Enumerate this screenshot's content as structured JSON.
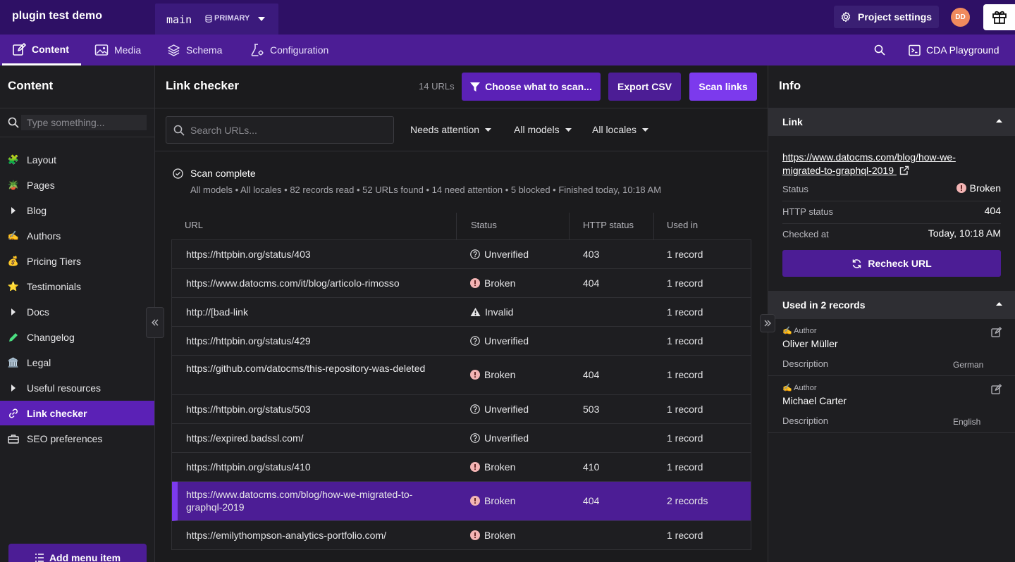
{
  "app": {
    "title": "plugin test demo"
  },
  "environment": {
    "name": "main",
    "badge": "PRIMARY"
  },
  "topbar": {
    "project_settings": "Project settings",
    "avatar_initials": "DD"
  },
  "nav": {
    "tabs": [
      {
        "label": "Content",
        "icon": "edit-icon",
        "active": true
      },
      {
        "label": "Media",
        "icon": "image-icon"
      },
      {
        "label": "Schema",
        "icon": "layers-icon"
      },
      {
        "label": "Configuration",
        "icon": "flask-icon"
      }
    ],
    "cda_playground": "CDA Playground"
  },
  "sidebar": {
    "title": "Content",
    "search_placeholder": "Type something...",
    "items": [
      {
        "label": "Layout",
        "icon": "🧩"
      },
      {
        "label": "Pages",
        "icon": "🪴"
      },
      {
        "label": "Blog",
        "icon": "caret-right-icon"
      },
      {
        "label": "Authors",
        "icon": "✍️"
      },
      {
        "label": "Pricing Tiers",
        "icon": "💰"
      },
      {
        "label": "Testimonials",
        "icon": "⭐"
      },
      {
        "label": "Docs",
        "icon": "caret-right-icon"
      },
      {
        "label": "Changelog",
        "icon": "pencil-icon"
      },
      {
        "label": "Legal",
        "icon": "🏛️"
      },
      {
        "label": "Useful resources",
        "icon": "caret-right-icon"
      },
      {
        "label": "Link checker",
        "icon": "link-icon",
        "active": true
      },
      {
        "label": "SEO preferences",
        "icon": "toolbox-icon"
      }
    ],
    "add_menu_item": "Add menu item"
  },
  "main": {
    "title": "Link checker",
    "url_count": "14 URLs",
    "buttons": {
      "choose": "Choose what to scan...",
      "export": "Export CSV",
      "scan": "Scan links"
    },
    "search_placeholder": "Search URLs...",
    "filters": {
      "attention": "Needs attention",
      "models": "All models",
      "locales": "All locales"
    },
    "scan_status": {
      "title": "Scan complete",
      "summary": "All models • All locales • 82 records read • 52 URLs found • 14 need attention • 5 blocked • Finished today, 10:18 AM"
    },
    "table": {
      "columns": [
        "URL",
        "Status",
        "HTTP status",
        "Used in"
      ],
      "rows": [
        {
          "url": "https://httpbin.org/status/403",
          "status": "Unverified",
          "kind": "unverified",
          "http": "403",
          "used": "1 record"
        },
        {
          "url": "https://www.datocms.com/it/blog/articolo-rimosso",
          "status": "Broken",
          "kind": "broken",
          "http": "404",
          "used": "1 record"
        },
        {
          "url": "http://[bad-link",
          "status": "Invalid",
          "kind": "invalid",
          "http": "",
          "used": "1 record"
        },
        {
          "url": "https://httpbin.org/status/429",
          "status": "Unverified",
          "kind": "unverified",
          "http": "",
          "used": "1 record"
        },
        {
          "url": "https://github.com/datocms/this-repository-was-deleted",
          "status": "Broken",
          "kind": "broken",
          "http": "404",
          "used": "1 record"
        },
        {
          "url": "https://httpbin.org/status/503",
          "status": "Unverified",
          "kind": "unverified",
          "http": "503",
          "used": "1 record"
        },
        {
          "url": "https://expired.badssl.com/",
          "status": "Unverified",
          "kind": "unverified",
          "http": "",
          "used": "1 record"
        },
        {
          "url": "https://httpbin.org/status/410",
          "status": "Broken",
          "kind": "broken",
          "http": "410",
          "used": "1 record"
        },
        {
          "url": "https://www.datocms.com/blog/how-we-migrated-to-graphql-2019",
          "status": "Broken",
          "kind": "broken",
          "http": "404",
          "used": "2 records",
          "selected": true
        },
        {
          "url": "https://emilythompson-analytics-portfolio.com/",
          "status": "Broken",
          "kind": "broken",
          "http": "",
          "used": "1 record"
        }
      ]
    }
  },
  "info": {
    "title": "Info",
    "link_section": "Link",
    "link_url": "https://www.datocms.com/blog/how-we-migrated-to-graphql-2019",
    "status_label": "Status",
    "status_value": "Broken",
    "http_label": "HTTP status",
    "http_value": "404",
    "checked_label": "Checked at",
    "checked_value": "Today, 10:18 AM",
    "recheck": "Recheck URL",
    "used_section": "Used in 2 records",
    "records": [
      {
        "model": "Author",
        "name": "Oliver Müller",
        "field": "Description",
        "locale": "German"
      },
      {
        "model": "Author",
        "name": "Michael Carter",
        "field": "Description",
        "locale": "English"
      }
    ]
  },
  "colors": {
    "topbar": "#2e1065",
    "navbar": "#4c1d95",
    "accent": "#7c3aed",
    "broken": "#f3b4b4"
  }
}
